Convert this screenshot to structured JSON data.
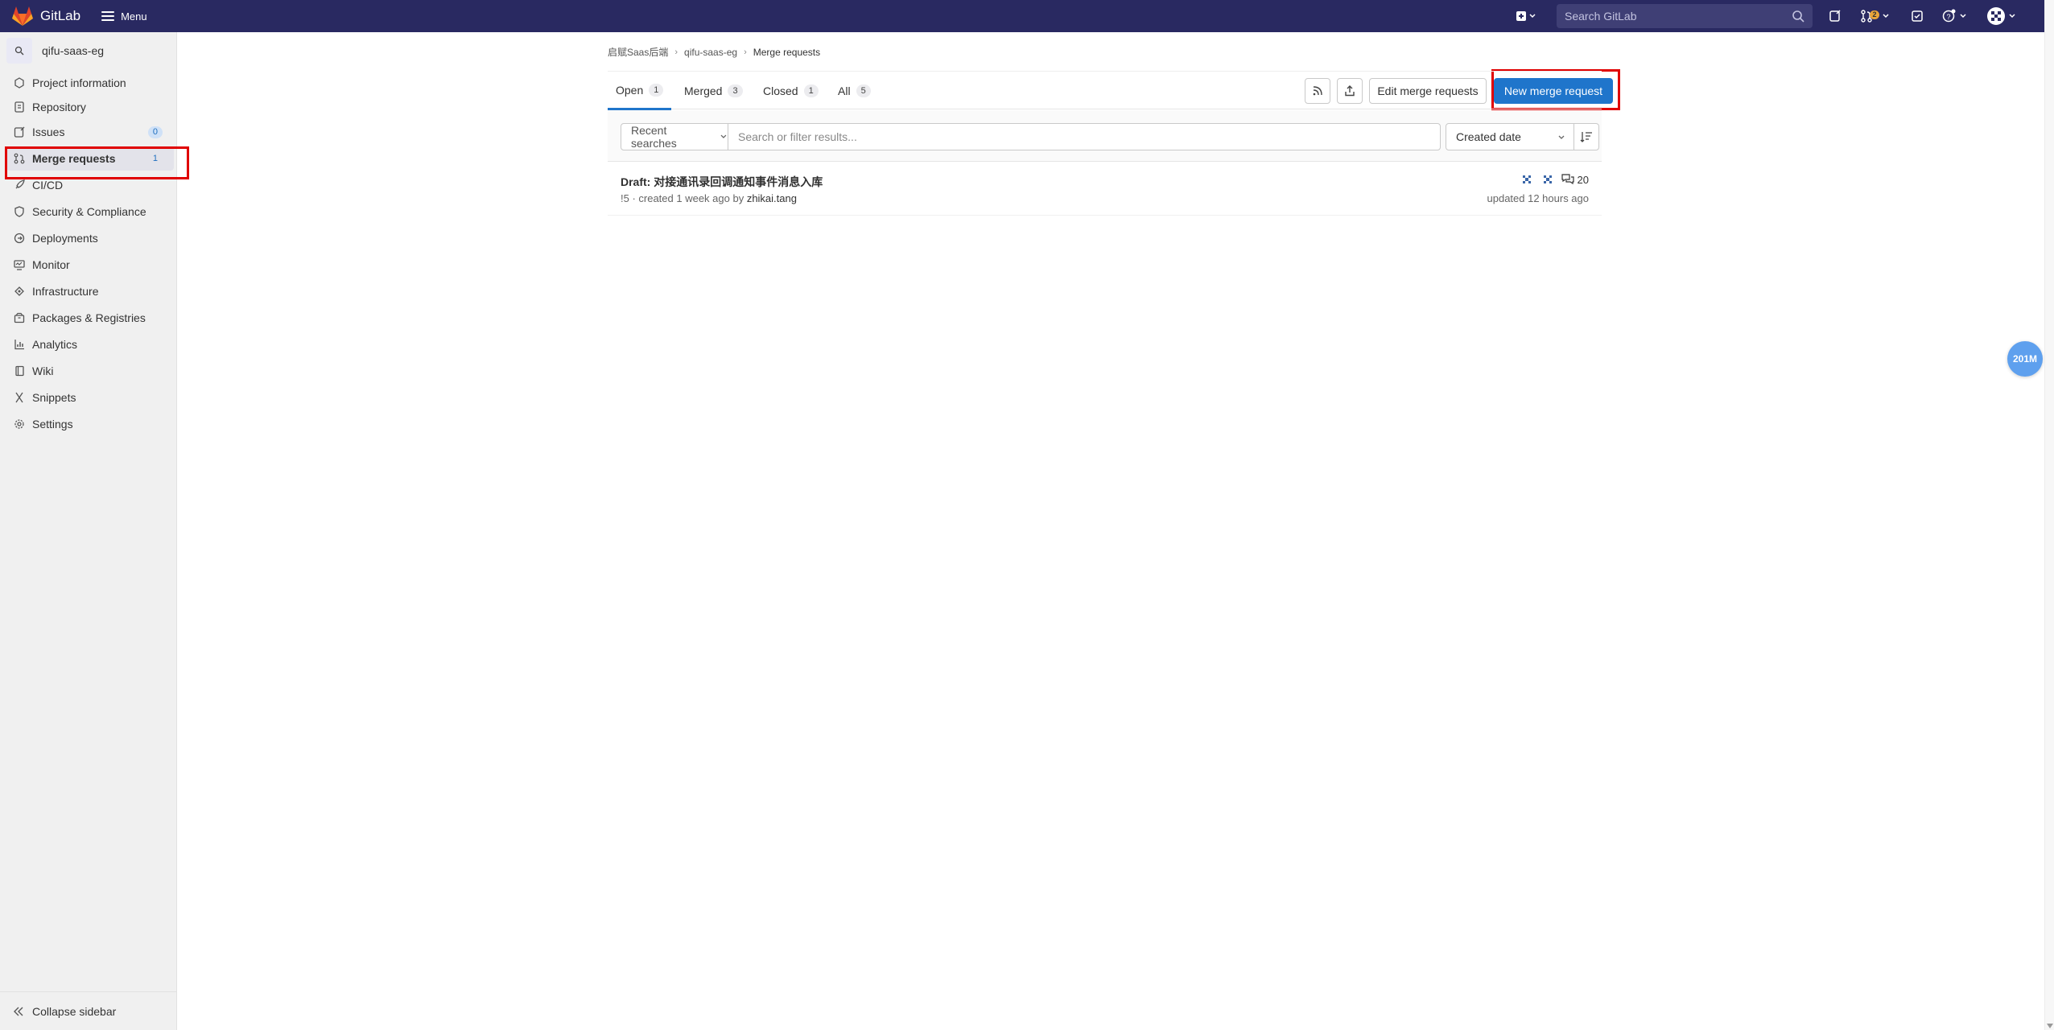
{
  "navbar": {
    "brand": "GitLab",
    "menu_label": "Menu",
    "search_placeholder": "Search GitLab",
    "mr_badge": "2"
  },
  "sidebar": {
    "project_name": "qifu-saas-eg",
    "items": [
      {
        "label": "Project information",
        "icon": "project-icon"
      },
      {
        "label": "Repository",
        "icon": "doc-icon"
      },
      {
        "label": "Issues",
        "icon": "issues-icon",
        "badge": "0"
      },
      {
        "label": "Merge requests",
        "icon": "merge-request-icon",
        "badge": "1"
      },
      {
        "label": "CI/CD",
        "icon": "rocket-icon"
      },
      {
        "label": "Security & Compliance",
        "icon": "shield-icon"
      },
      {
        "label": "Deployments",
        "icon": "deployments-icon"
      },
      {
        "label": "Monitor",
        "icon": "monitor-icon"
      },
      {
        "label": "Infrastructure",
        "icon": "cloud-icon"
      },
      {
        "label": "Packages & Registries",
        "icon": "package-icon"
      },
      {
        "label": "Analytics",
        "icon": "chart-icon"
      },
      {
        "label": "Wiki",
        "icon": "book-icon"
      },
      {
        "label": "Snippets",
        "icon": "scissors-icon"
      },
      {
        "label": "Settings",
        "icon": "gear-icon"
      }
    ],
    "collapse_label": "Collapse sidebar"
  },
  "breadcrumb": [
    "启赋Saas后端",
    "qifu-saas-eg",
    "Merge requests"
  ],
  "tabs": [
    {
      "label": "Open",
      "count": "1"
    },
    {
      "label": "Merged",
      "count": "3"
    },
    {
      "label": "Closed",
      "count": "1"
    },
    {
      "label": "All",
      "count": "5"
    }
  ],
  "actions": {
    "edit_label": "Edit merge requests",
    "new_label": "New merge request"
  },
  "filter": {
    "recent_label": "Recent searches",
    "placeholder": "Search or filter results...",
    "sort_label": "Created date"
  },
  "merge_requests": [
    {
      "title": "Draft: 对接通讯录回调通知事件消息入库",
      "meta_prefix": "!5 · created 1 week ago by ",
      "author": "zhikai.tang",
      "comments": "20",
      "updated": "updated 12 hours ago"
    }
  ],
  "float_badge": "201M",
  "colors": {
    "navbar": "#292961",
    "primary": "#1f75cb",
    "highlight": "#e00000"
  }
}
